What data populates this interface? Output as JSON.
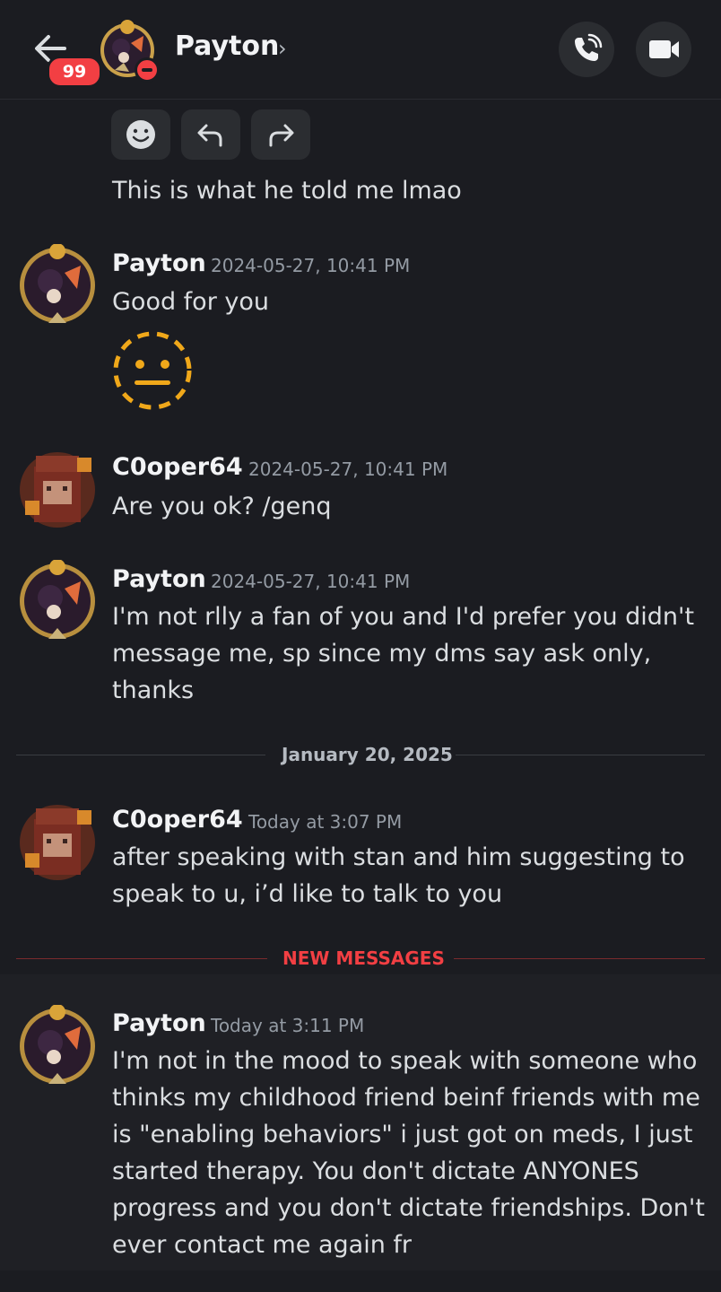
{
  "header": {
    "title": "Payton",
    "unread_badge": "99",
    "chevron": "›",
    "icons": [
      "back-arrow-icon",
      "dnd-status-icon",
      "phone-call-icon",
      "video-camera-icon"
    ]
  },
  "reaction_bar": {
    "icons": [
      "smiley-icon",
      "reply-icon",
      "forward-icon"
    ]
  },
  "messages": [
    {
      "text": "This is what he told me lmao"
    },
    {
      "author": "Payton",
      "timestamp": "2024-05-27, 10:41 PM",
      "lines": [
        "Good for you"
      ],
      "emoji": "neutral-face-dotted"
    },
    {
      "author": "C0oper64",
      "timestamp": "2024-05-27, 10:41 PM",
      "lines": [
        "Are you ok? /genq"
      ]
    },
    {
      "author": "Payton",
      "timestamp": "2024-05-27, 10:41 PM",
      "lines": [
        "I'm not rlly a fan of you and I'd prefer you didn't",
        "message me, sp since my dms say ask only,",
        "thanks"
      ]
    },
    {
      "author": "C0oper64",
      "timestamp": "Today at 3:07 PM",
      "lines": [
        "after speaking with stan and him suggesting to",
        "speak to u, i’d like to talk to you"
      ]
    },
    {
      "author": "Payton",
      "timestamp": "Today at 3:11 PM",
      "lines": [
        "I'm not in the mood to speak with someone who",
        "thinks my childhood friend beinf friends with me",
        "is \"enabling behaviors\" i just got on meds, I just",
        "started therapy. You don't dictate ANYONES",
        "progress and you don't dictate friendships. Don't",
        "ever contact me again fr"
      ]
    }
  ],
  "date_divider": "January 20, 2025",
  "new_messages_divider": "NEW MESSAGES",
  "colors": {
    "background": "#1b1c21",
    "new_messages_red": "#f23f43",
    "emoji_yellow": "#f0a81a"
  }
}
